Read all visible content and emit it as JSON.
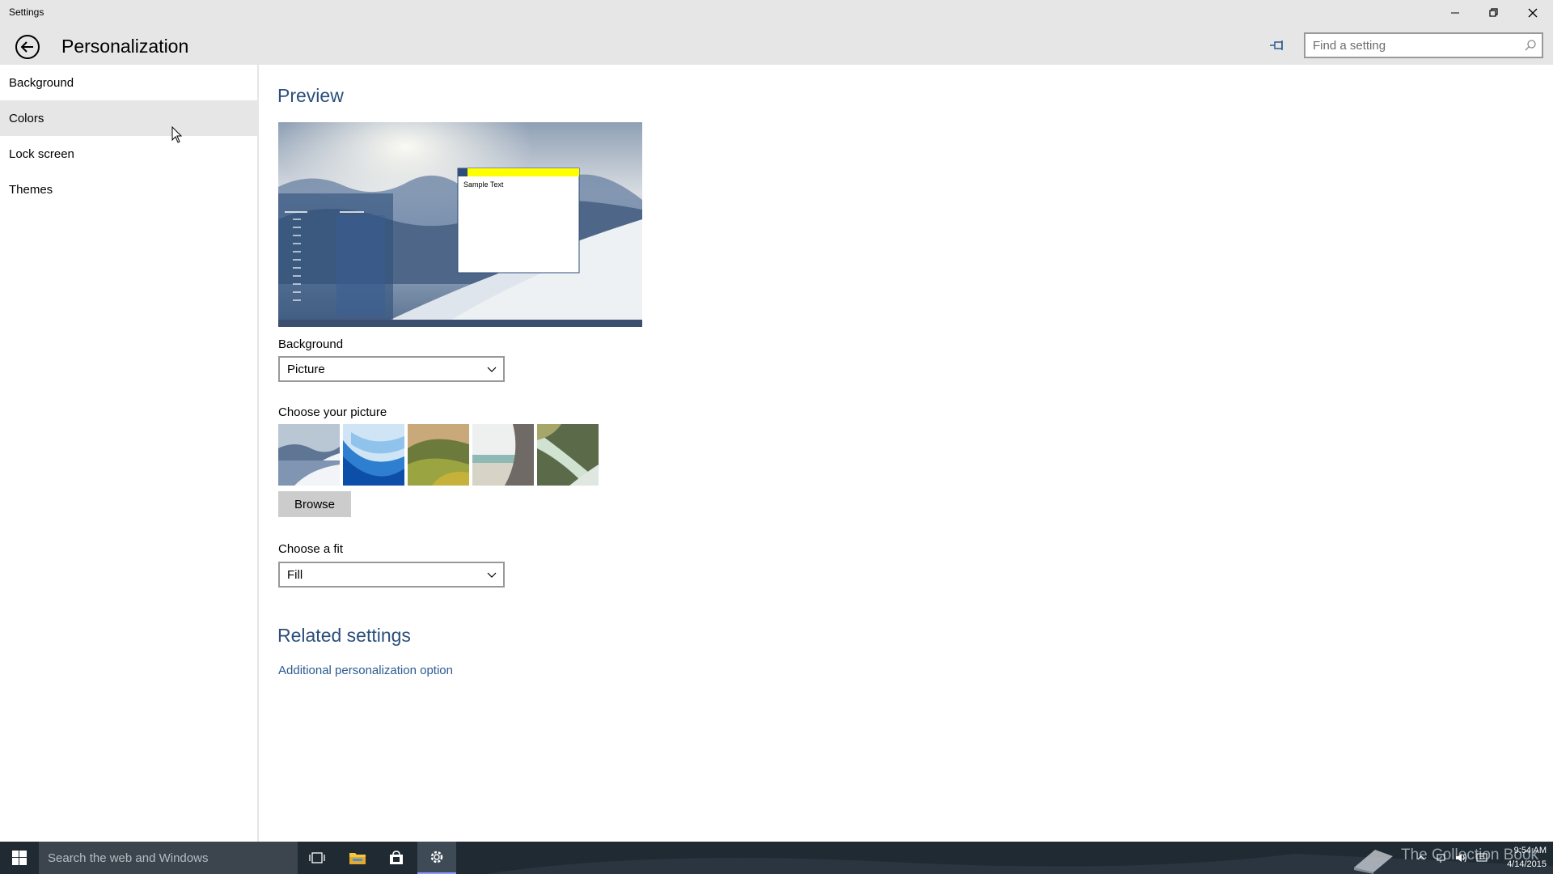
{
  "window": {
    "title": "Settings",
    "minimize_icon": "minimize-icon",
    "restore_icon": "restore-icon",
    "close_icon": "close-icon"
  },
  "header": {
    "back_icon": "back-arrow-icon",
    "title": "Personalization",
    "pin_icon": "pin-icon",
    "search_placeholder": "Find a setting",
    "search_icon": "search-icon"
  },
  "sidebar": {
    "items": [
      {
        "label": "Background",
        "selected": false
      },
      {
        "label": "Colors",
        "selected": true
      },
      {
        "label": "Lock screen",
        "selected": false
      },
      {
        "label": "Themes",
        "selected": false
      }
    ]
  },
  "main": {
    "preview_title": "Preview",
    "preview_sample_text": "Sample Text",
    "accent_color": "#ffff00",
    "background_label": "Background",
    "background_value": "Picture",
    "choose_picture_label": "Choose your picture",
    "pictures": [
      {
        "name": "snowy-mountains"
      },
      {
        "name": "blue-wave"
      },
      {
        "name": "green-hills"
      },
      {
        "name": "beach-rock"
      },
      {
        "name": "aerial-river"
      }
    ],
    "browse_label": "Browse",
    "fit_label": "Choose a fit",
    "fit_value": "Fill",
    "related_title": "Related settings",
    "related_link": "Additional personalization option"
  },
  "taskbar": {
    "search_placeholder": "Search the web and Windows",
    "watermark": "The Collection Book",
    "time": "9:54 AM",
    "date": "4/14/2015",
    "icons": [
      "task-view-icon",
      "file-explorer-icon",
      "store-icon",
      "settings-icon"
    ]
  }
}
